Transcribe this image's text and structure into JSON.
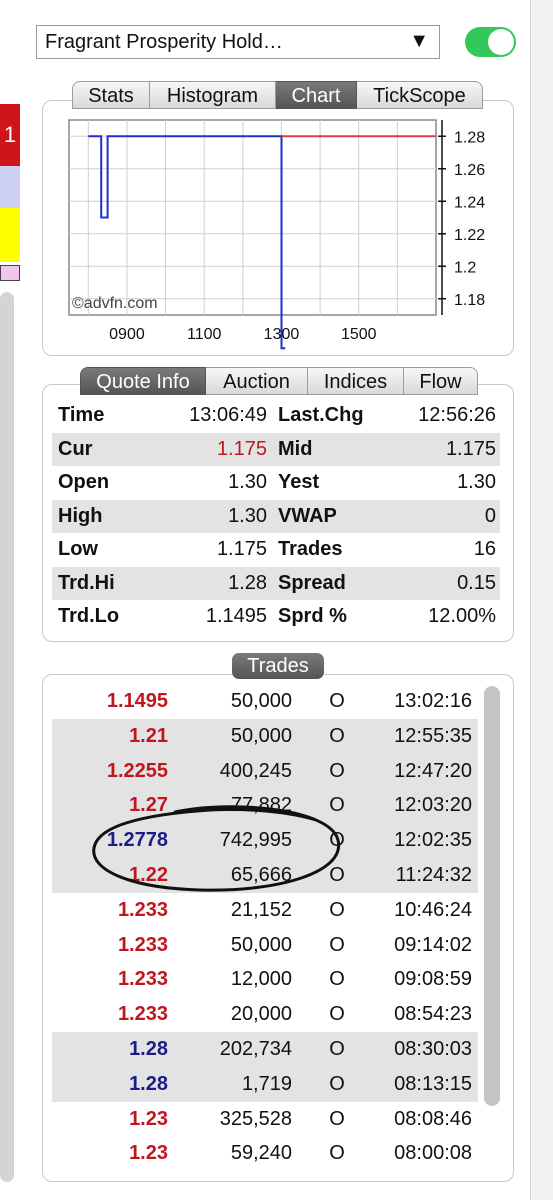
{
  "left_strip": {
    "badge": "1"
  },
  "header": {
    "instrument_select": "Fragrant Prosperity Hold…",
    "toggle_on": true
  },
  "chart_tabs": [
    {
      "label": "Stats",
      "active": false
    },
    {
      "label": "Histogram",
      "active": false
    },
    {
      "label": "Chart",
      "active": true
    },
    {
      "label": "TickScope",
      "active": false
    }
  ],
  "chart_data": {
    "type": "line",
    "watermark": "©advfn.com",
    "x_ticks": [
      "0900",
      "1100",
      "1300",
      "1500"
    ],
    "y_ticks": [
      "1.28",
      "1.26",
      "1.24",
      "1.22",
      "1.2",
      "1.18"
    ],
    "ylim": [
      1.17,
      1.29
    ],
    "series": [
      {
        "color": "#1f2fd0",
        "points": [
          [
            "08:00",
            1.28
          ],
          [
            "08:20",
            1.28
          ],
          [
            "08:20",
            1.23
          ],
          [
            "08:30",
            1.23
          ],
          [
            "08:30",
            1.28
          ],
          [
            "13:00",
            1.28
          ],
          [
            "13:00",
            1.1495
          ],
          [
            "13:06",
            1.1495
          ]
        ]
      },
      {
        "color": "#e23b3b",
        "points": [
          [
            "13:00",
            1.28
          ],
          [
            "17:00",
            1.28
          ]
        ]
      }
    ]
  },
  "quote_tabs": [
    {
      "label": "Quote Info",
      "active": true
    },
    {
      "label": "Auction",
      "active": false
    },
    {
      "label": "Indices",
      "active": false
    },
    {
      "label": "Flow",
      "active": false
    }
  ],
  "quote_rows": [
    {
      "k1": "Time",
      "v1": "13:06:49",
      "k2": "Last.Chg",
      "v2": "12:56:26"
    },
    {
      "k1": "Cur",
      "v1": "1.175",
      "k2": "Mid",
      "v2": "1.175"
    },
    {
      "k1": "Open",
      "v1": "1.30",
      "k2": "Yest",
      "v2": "1.30"
    },
    {
      "k1": "High",
      "v1": "1.30",
      "k2": "VWAP",
      "v2": "0"
    },
    {
      "k1": "Low",
      "v1": "1.175",
      "k2": "Trades",
      "v2": "16"
    },
    {
      "k1": "Trd.Hi",
      "v1": "1.28",
      "k2": "Spread",
      "v2": "0.15"
    },
    {
      "k1": "Trd.Lo",
      "v1": "1.1495",
      "k2": "Sprd %",
      "v2": "12.00%"
    }
  ],
  "trades_label": "Trades",
  "trades": [
    {
      "price": "1.1495",
      "volume": "50,000",
      "code": "O",
      "time": "13:02:16",
      "dir": "down"
    },
    {
      "price": "1.21",
      "volume": "50,000",
      "code": "O",
      "time": "12:55:35",
      "dir": "down"
    },
    {
      "price": "1.2255",
      "volume": "400,245",
      "code": "O",
      "time": "12:47:20",
      "dir": "down"
    },
    {
      "price": "1.27",
      "volume": "77,882",
      "code": "O",
      "time": "12:03:20",
      "dir": "down"
    },
    {
      "price": "1.2778",
      "volume": "742,995",
      "code": "O",
      "time": "12:02:35",
      "dir": "up"
    },
    {
      "price": "1.22",
      "volume": "65,666",
      "code": "O",
      "time": "11:24:32",
      "dir": "down"
    },
    {
      "price": "1.233",
      "volume": "21,152",
      "code": "O",
      "time": "10:46:24",
      "dir": "down"
    },
    {
      "price": "1.233",
      "volume": "50,000",
      "code": "O",
      "time": "09:14:02",
      "dir": "down"
    },
    {
      "price": "1.233",
      "volume": "12,000",
      "code": "O",
      "time": "09:08:59",
      "dir": "down"
    },
    {
      "price": "1.233",
      "volume": "20,000",
      "code": "O",
      "time": "08:54:23",
      "dir": "down"
    },
    {
      "price": "1.28",
      "volume": "202,734",
      "code": "O",
      "time": "08:30:03",
      "dir": "up"
    },
    {
      "price": "1.28",
      "volume": "1,719",
      "code": "O",
      "time": "08:13:15",
      "dir": "up"
    },
    {
      "price": "1.23",
      "volume": "325,528",
      "code": "O",
      "time": "08:08:46",
      "dir": "down"
    },
    {
      "price": "1.23",
      "volume": "59,240",
      "code": "O",
      "time": "08:00:08",
      "dir": "down"
    }
  ]
}
